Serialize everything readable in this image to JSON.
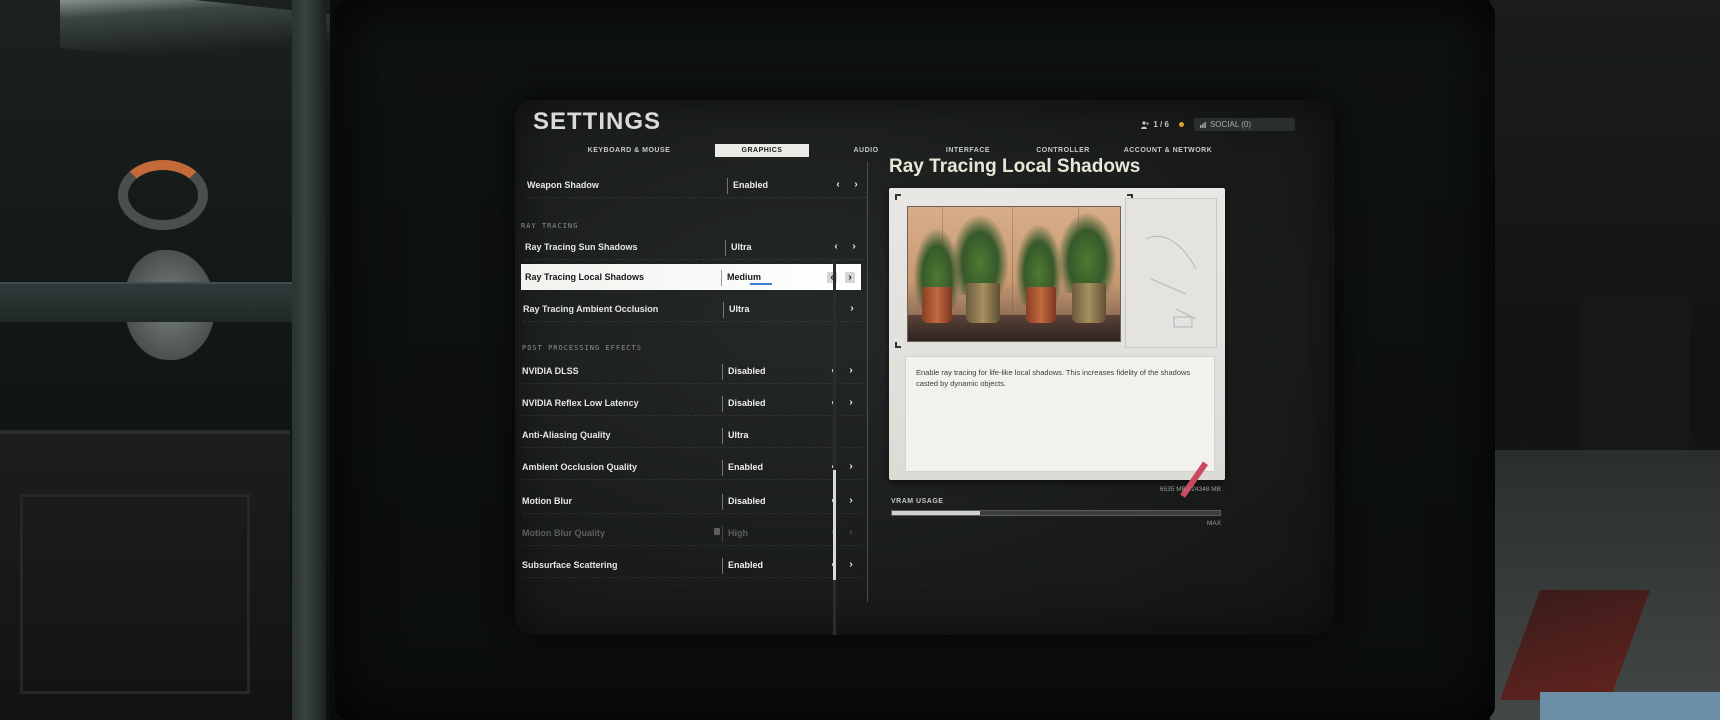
{
  "header": {
    "title": "SETTINGS",
    "party_count": "1 / 6",
    "social_label": "SOCIAL (0)"
  },
  "tabs": [
    {
      "label": "KEYBOARD & MOUSE",
      "active": false
    },
    {
      "label": "GRAPHICS",
      "active": true
    },
    {
      "label": "AUDIO",
      "active": false
    },
    {
      "label": "INTERFACE",
      "active": false
    },
    {
      "label": "CONTROLLER",
      "active": false
    },
    {
      "label": "ACCOUNT & NETWORK",
      "active": false
    }
  ],
  "settings": {
    "weapon_shadow": {
      "label": "Weapon Shadow",
      "value": "Enabled"
    },
    "section_ray_tracing": "RAY TRACING",
    "rt_sun_shadows": {
      "label": "Ray Tracing Sun Shadows",
      "value": "Ultra"
    },
    "rt_local_shadows": {
      "label": "Ray Tracing Local Shadows",
      "value": "Medium",
      "selected": true
    },
    "rt_ambient_occlusion": {
      "label": "Ray Tracing Ambient Occlusion",
      "value": "Ultra"
    },
    "section_post_processing": "POST PROCESSING EFFECTS",
    "nvidia_dlss": {
      "label": "NVIDIA DLSS",
      "value": "Disabled"
    },
    "nvidia_reflex": {
      "label": "NVIDIA Reflex Low Latency",
      "value": "Disabled"
    },
    "anti_aliasing": {
      "label": "Anti-Aliasing Quality",
      "value": "Ultra"
    },
    "ao_quality": {
      "label": "Ambient Occlusion Quality",
      "value": "Enabled"
    },
    "motion_blur": {
      "label": "Motion Blur",
      "value": "Disabled"
    },
    "motion_blur_quality": {
      "label": "Motion Blur Quality",
      "value": "High",
      "locked": true
    },
    "subsurface_scattering": {
      "label": "Subsurface Scattering",
      "value": "Enabled"
    }
  },
  "detail": {
    "title": "Ray Tracing Local Shadows",
    "description": "Enable ray tracing for life-like local shadows. This increases fidelity of the shadows casted by dynamic objects."
  },
  "vram": {
    "label": "VRAM USAGE",
    "usage_text": "6535 MB / 24348 MB",
    "max_label": "MAX",
    "used_mb": 6535,
    "total_mb": 24348
  },
  "icons": {
    "arrow_left": "‹",
    "arrow_right": "›",
    "party": "party-icon",
    "lock": "lock-icon"
  },
  "colors": {
    "accent_blue": "#3a7fd0",
    "highlight_row": "#ffffff",
    "status_dot": "#d4a02a"
  }
}
